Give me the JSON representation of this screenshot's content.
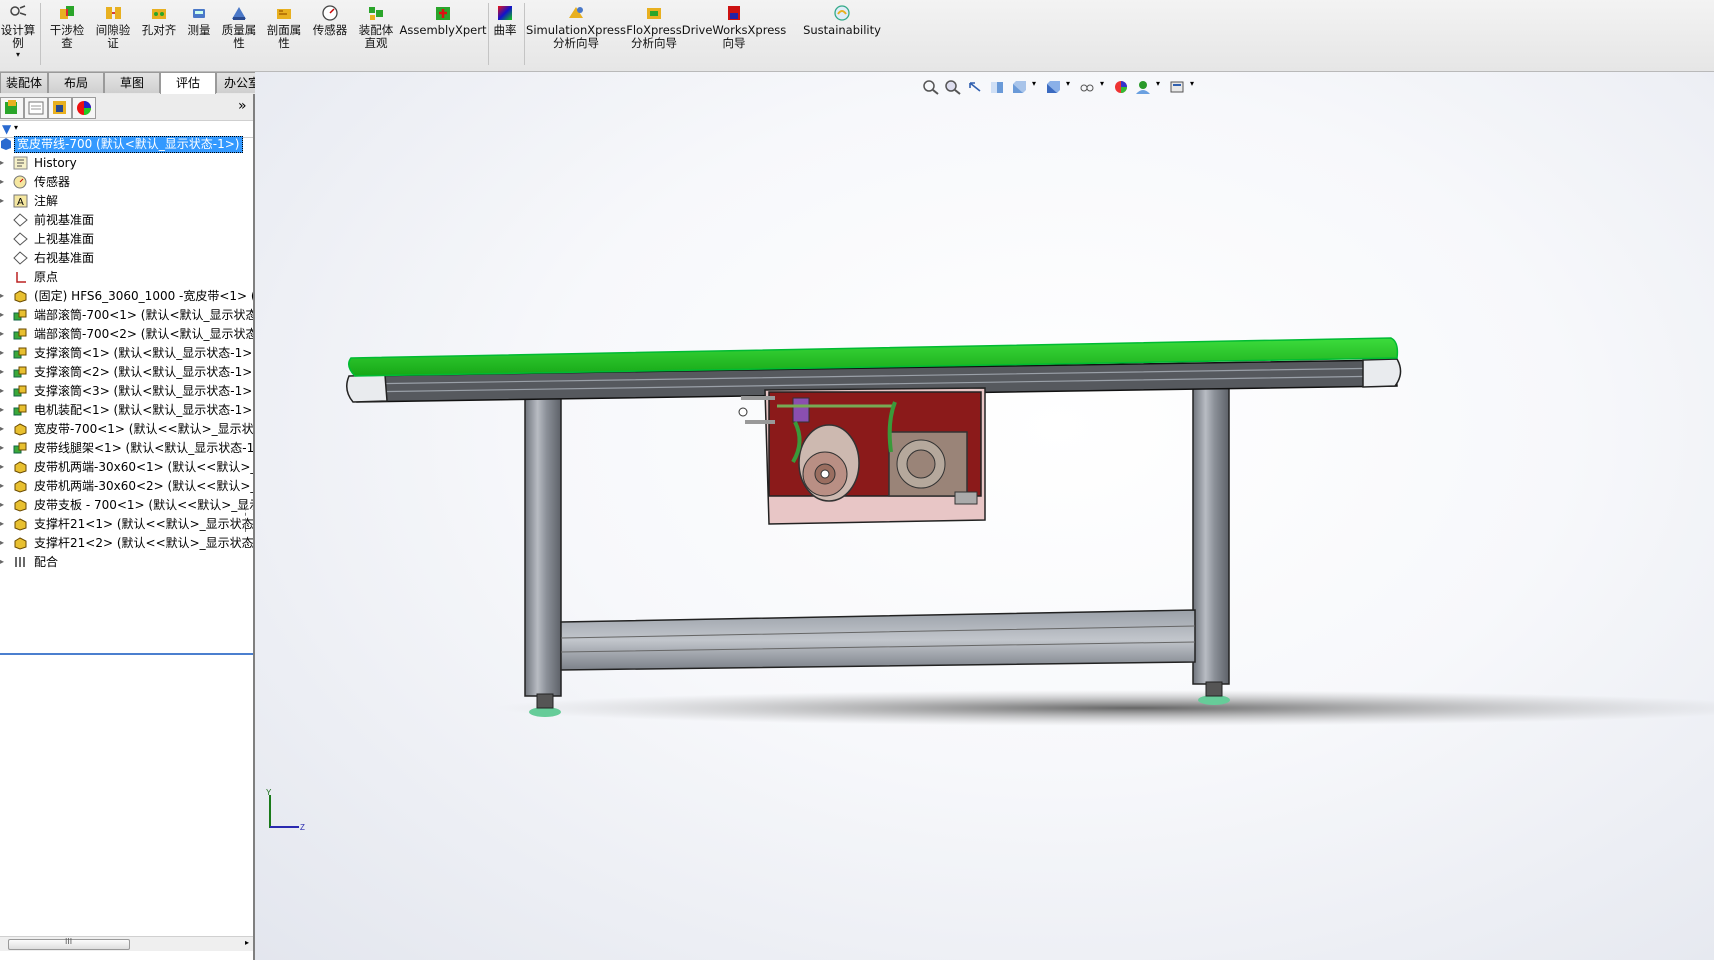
{
  "ribbon": {
    "buttons": [
      {
        "id": "design-study",
        "label": "设计算\n例"
      },
      {
        "id": "interference",
        "label": "干涉检\n查"
      },
      {
        "id": "clearance",
        "label": "间隙验\n证"
      },
      {
        "id": "hole-align",
        "label": "孔对齐"
      },
      {
        "id": "measure",
        "label": "测量"
      },
      {
        "id": "mass-props",
        "label": "质量属\n性"
      },
      {
        "id": "section-props",
        "label": "剖面属\n性"
      },
      {
        "id": "sensor",
        "label": "传感器"
      },
      {
        "id": "assembly-viz",
        "label": "装配体\n直观"
      },
      {
        "id": "assemblyxpert",
        "label": "AssemblyXpert"
      },
      {
        "id": "curvature",
        "label": "曲率"
      },
      {
        "id": "simulationxpress",
        "label": "SimulationXpress\n分析向导"
      },
      {
        "id": "floxpress",
        "label": "FloXpress\n分析向导"
      },
      {
        "id": "driveworksxpress",
        "label": "DriveWorksXpress\n向导"
      },
      {
        "id": "sustainability",
        "label": "Sustainability"
      }
    ]
  },
  "tabs": [
    {
      "label": "装配体"
    },
    {
      "label": "布局"
    },
    {
      "label": "草图"
    },
    {
      "label": "评估",
      "active": true
    },
    {
      "label": "办公室产品"
    }
  ],
  "feature_tree": {
    "root": "宽皮带线-700  (默认<默认_显示状态-1>)",
    "items": [
      {
        "label": "History",
        "icon": "history-icon"
      },
      {
        "label": "传感器",
        "icon": "sensor-icon"
      },
      {
        "label": "注解",
        "icon": "annotation-icon"
      },
      {
        "label": "前视基准面",
        "icon": "plane-icon"
      },
      {
        "label": "上视基准面",
        "icon": "plane-icon"
      },
      {
        "label": "右视基准面",
        "icon": "plane-icon"
      },
      {
        "label": "原点",
        "icon": "origin-icon"
      },
      {
        "label": "(固定) HFS6_3060_1000 -宽皮带<1> (H",
        "icon": "part-icon"
      },
      {
        "label": "端部滚筒-700<1> (默认<默认_显示状态",
        "icon": "subassembly-icon"
      },
      {
        "label": "端部滚筒-700<2> (默认<默认_显示状态",
        "icon": "subassembly-icon"
      },
      {
        "label": "支撑滚筒<1> (默认<默认_显示状态-1>)",
        "icon": "subassembly-icon"
      },
      {
        "label": "支撑滚筒<2> (默认<默认_显示状态-1>)",
        "icon": "subassembly-icon"
      },
      {
        "label": "支撑滚筒<3> (默认<默认_显示状态-1>)",
        "icon": "subassembly-icon"
      },
      {
        "label": "电机装配<1> (默认<默认_显示状态-1>)",
        "icon": "subassembly-icon"
      },
      {
        "label": "宽皮带-700<1> (默认<<默认>_显示状态",
        "icon": "part-icon"
      },
      {
        "label": "皮带线腿架<1> (默认<默认_显示状态-1",
        "icon": "subassembly-icon"
      },
      {
        "label": "皮带机两端-30x60<1> (默认<<默认>_显",
        "icon": "part-icon"
      },
      {
        "label": "皮带机两端-30x60<2> (默认<<默认>_显",
        "icon": "part-icon"
      },
      {
        "label": "皮带支板 - 700<1> (默认<<默认>_显示",
        "icon": "part-icon"
      },
      {
        "label": "支撑杆21<1> (默认<<默认>_显示状态",
        "icon": "part-icon"
      },
      {
        "label": "支撑杆21<2> (默认<<默认>_显示状态",
        "icon": "part-icon"
      },
      {
        "label": "配合",
        "icon": "mates-icon"
      }
    ]
  },
  "scroll": {
    "thumb_label": "III"
  },
  "triad": {
    "y_label": "Y",
    "z_label": "Z"
  },
  "colors": {
    "belt": "#22cc22",
    "frame": "#8e939c",
    "motor_plate": "#8b1a1a",
    "selection": "#3399ff"
  }
}
